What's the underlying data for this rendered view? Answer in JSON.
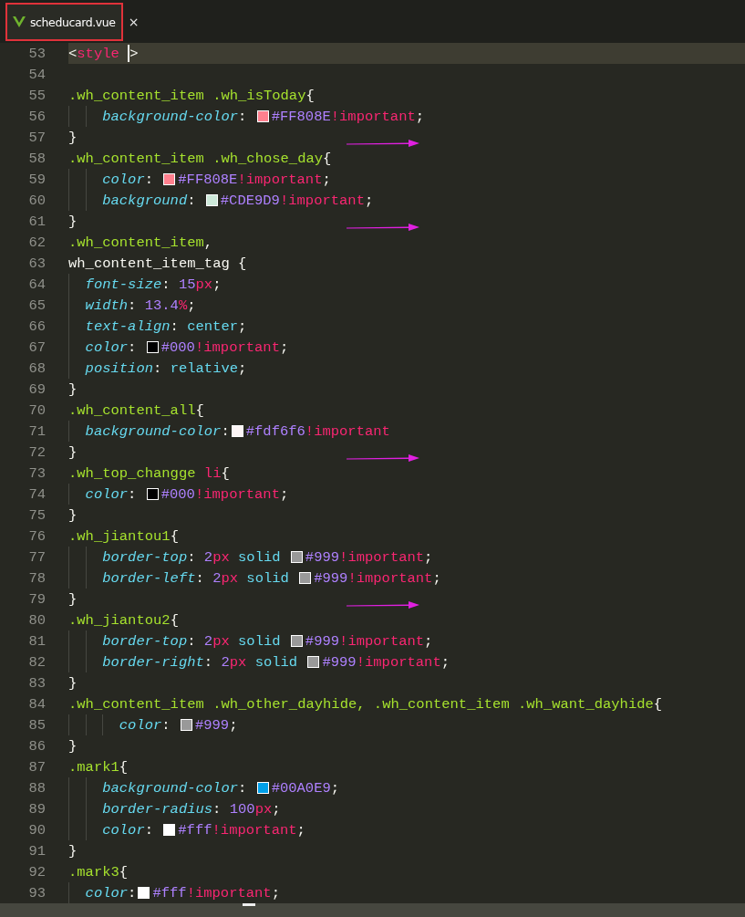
{
  "tab": {
    "title": "scheducard.vue",
    "close": "×",
    "highlighted": true
  },
  "lines": [
    {
      "number": "53",
      "kind": "top",
      "current": true,
      "arrow": false,
      "tokens": [
        {
          "kind": "punct",
          "text": "<"
        },
        {
          "kind": "tag",
          "text": "style"
        },
        {
          "kind": "cursor"
        },
        {
          "kind": "punct",
          "text": ">"
        }
      ]
    },
    {
      "number": "54",
      "kind": "top",
      "current": false,
      "arrow": false
    },
    {
      "number": "55",
      "kind": "top",
      "current": false,
      "arrow": false,
      "tokens": [
        {
          "kind": "sel",
          "text": ".wh_content_item .wh_isToday"
        },
        {
          "kind": "punct",
          "text": "{"
        }
      ]
    },
    {
      "number": "56",
      "kind": "double",
      "current": false,
      "arrow": false,
      "tokens": [
        {
          "kind": "prop",
          "text": "background-color"
        },
        {
          "kind": "punct",
          "text": ": "
        },
        {
          "kind": "swatch",
          "color": "#ff808e"
        },
        {
          "kind": "num",
          "text": "#FF808E"
        },
        {
          "kind": "kw",
          "text": "!important"
        },
        {
          "kind": "punct",
          "text": ";"
        }
      ]
    },
    {
      "number": "57",
      "kind": "top",
      "current": false,
      "arrow": true,
      "tokens": [
        {
          "kind": "punct",
          "text": "}"
        }
      ]
    },
    {
      "number": "58",
      "kind": "top",
      "current": false,
      "arrow": false,
      "tokens": [
        {
          "kind": "sel",
          "text": ".wh_content_item .wh_chose_day"
        },
        {
          "kind": "punct",
          "text": "{"
        }
      ]
    },
    {
      "number": "59",
      "kind": "double",
      "current": false,
      "arrow": false,
      "tokens": [
        {
          "kind": "prop",
          "text": "color"
        },
        {
          "kind": "punct",
          "text": ": "
        },
        {
          "kind": "swatch",
          "color": "#ff808e"
        },
        {
          "kind": "num",
          "text": "#FF808E"
        },
        {
          "kind": "kw",
          "text": "!important"
        },
        {
          "kind": "punct",
          "text": ";"
        }
      ]
    },
    {
      "number": "60",
      "kind": "double",
      "current": false,
      "arrow": false,
      "tokens": [
        {
          "kind": "prop",
          "text": "background"
        },
        {
          "kind": "punct",
          "text": ": "
        },
        {
          "kind": "swatch",
          "color": "#cde9d9"
        },
        {
          "kind": "num",
          "text": "#CDE9D9"
        },
        {
          "kind": "kw",
          "text": "!important"
        },
        {
          "kind": "punct",
          "text": ";"
        }
      ]
    },
    {
      "number": "61",
      "kind": "top",
      "current": false,
      "arrow": true,
      "tokens": [
        {
          "kind": "punct",
          "text": "}"
        }
      ]
    },
    {
      "number": "62",
      "kind": "top",
      "current": false,
      "arrow": false,
      "tokens": [
        {
          "kind": "sel",
          "text": ".wh_content_item"
        },
        {
          "kind": "punct",
          "text": ","
        }
      ]
    },
    {
      "number": "63",
      "kind": "top",
      "current": false,
      "arrow": false,
      "tokens": [
        {
          "kind": "punct",
          "text": "wh_content_item_tag {"
        }
      ]
    },
    {
      "number": "64",
      "kind": "single",
      "current": false,
      "arrow": false,
      "tokens": [
        {
          "kind": "prop",
          "text": "font-size"
        },
        {
          "kind": "punct",
          "text": ": "
        },
        {
          "kind": "num",
          "text": "15"
        },
        {
          "kind": "kw",
          "text": "px"
        },
        {
          "kind": "punct",
          "text": ";"
        }
      ]
    },
    {
      "number": "65",
      "kind": "single",
      "current": false,
      "arrow": false,
      "tokens": [
        {
          "kind": "prop",
          "text": "width"
        },
        {
          "kind": "punct",
          "text": ": "
        },
        {
          "kind": "num",
          "text": "13.4"
        },
        {
          "kind": "kw",
          "text": "%"
        },
        {
          "kind": "punct",
          "text": ";"
        }
      ]
    },
    {
      "number": "66",
      "kind": "single",
      "current": false,
      "arrow": false,
      "tokens": [
        {
          "kind": "prop",
          "text": "text-align"
        },
        {
          "kind": "punct",
          "text": ": "
        },
        {
          "kind": "val",
          "text": "center"
        },
        {
          "kind": "punct",
          "text": ";"
        }
      ]
    },
    {
      "number": "67",
      "kind": "single",
      "current": false,
      "arrow": false,
      "tokens": [
        {
          "kind": "prop",
          "text": "color"
        },
        {
          "kind": "punct",
          "text": ": "
        },
        {
          "kind": "swatch",
          "color": "#000000"
        },
        {
          "kind": "num",
          "text": "#000"
        },
        {
          "kind": "kw",
          "text": "!important"
        },
        {
          "kind": "punct",
          "text": ";"
        }
      ]
    },
    {
      "number": "68",
      "kind": "single",
      "current": false,
      "arrow": false,
      "tokens": [
        {
          "kind": "prop",
          "text": "position"
        },
        {
          "kind": "punct",
          "text": ": "
        },
        {
          "kind": "val",
          "text": "relative"
        },
        {
          "kind": "punct",
          "text": ";"
        }
      ]
    },
    {
      "number": "69",
      "kind": "top",
      "current": false,
      "arrow": false,
      "tokens": [
        {
          "kind": "punct",
          "text": "}"
        }
      ]
    },
    {
      "number": "70",
      "kind": "top",
      "current": false,
      "arrow": false,
      "tokens": [
        {
          "kind": "sel",
          "text": ".wh_content_all"
        },
        {
          "kind": "punct",
          "text": "{"
        }
      ]
    },
    {
      "number": "71",
      "kind": "single",
      "current": false,
      "arrow": false,
      "tokens": [
        {
          "kind": "prop",
          "text": "background-color"
        },
        {
          "kind": "punct",
          "text": ":"
        },
        {
          "kind": "swatch",
          "color": "#fdf6f6"
        },
        {
          "kind": "num",
          "text": "#fdf6f6"
        },
        {
          "kind": "kw",
          "text": "!important"
        }
      ]
    },
    {
      "number": "72",
      "kind": "top",
      "current": false,
      "arrow": true,
      "tokens": [
        {
          "kind": "punct",
          "text": "}"
        }
      ]
    },
    {
      "number": "73",
      "kind": "top",
      "current": false,
      "arrow": false,
      "tokens": [
        {
          "kind": "sel",
          "text": ".wh_top_changge "
        },
        {
          "kind": "kw",
          "text": "li"
        },
        {
          "kind": "punct",
          "text": "{"
        }
      ]
    },
    {
      "number": "74",
      "kind": "single",
      "current": false,
      "arrow": false,
      "tokens": [
        {
          "kind": "prop",
          "text": "color"
        },
        {
          "kind": "punct",
          "text": ": "
        },
        {
          "kind": "swatch",
          "color": "#000000"
        },
        {
          "kind": "num",
          "text": "#000"
        },
        {
          "kind": "kw",
          "text": "!important"
        },
        {
          "kind": "punct",
          "text": ";"
        }
      ]
    },
    {
      "number": "75",
      "kind": "top",
      "current": false,
      "arrow": false,
      "tokens": [
        {
          "kind": "punct",
          "text": "}"
        }
      ]
    },
    {
      "number": "76",
      "kind": "top",
      "current": false,
      "arrow": false,
      "tokens": [
        {
          "kind": "sel",
          "text": ".wh_jiantou1"
        },
        {
          "kind": "punct",
          "text": "{"
        }
      ]
    },
    {
      "number": "77",
      "kind": "double",
      "current": false,
      "arrow": false,
      "tokens": [
        {
          "kind": "prop",
          "text": "border-top"
        },
        {
          "kind": "punct",
          "text": ": "
        },
        {
          "kind": "num",
          "text": "2"
        },
        {
          "kind": "kw",
          "text": "px"
        },
        {
          "kind": "val",
          "text": " solid "
        },
        {
          "kind": "swatch",
          "color": "#999999"
        },
        {
          "kind": "num",
          "text": "#999"
        },
        {
          "kind": "kw",
          "text": "!important"
        },
        {
          "kind": "punct",
          "text": ";"
        }
      ]
    },
    {
      "number": "78",
      "kind": "double",
      "current": false,
      "arrow": false,
      "tokens": [
        {
          "kind": "prop",
          "text": "border-left"
        },
        {
          "kind": "punct",
          "text": ": "
        },
        {
          "kind": "num",
          "text": "2"
        },
        {
          "kind": "kw",
          "text": "px"
        },
        {
          "kind": "val",
          "text": " solid "
        },
        {
          "kind": "swatch",
          "color": "#999999"
        },
        {
          "kind": "num",
          "text": "#999"
        },
        {
          "kind": "kw",
          "text": "!important"
        },
        {
          "kind": "punct",
          "text": ";"
        }
      ]
    },
    {
      "number": "79",
      "kind": "top",
      "current": false,
      "arrow": true,
      "tokens": [
        {
          "kind": "punct",
          "text": "}"
        }
      ]
    },
    {
      "number": "80",
      "kind": "top",
      "current": false,
      "arrow": false,
      "tokens": [
        {
          "kind": "sel",
          "text": ".wh_jiantou2"
        },
        {
          "kind": "punct",
          "text": "{"
        }
      ]
    },
    {
      "number": "81",
      "kind": "double",
      "current": false,
      "arrow": false,
      "tokens": [
        {
          "kind": "prop",
          "text": "border-top"
        },
        {
          "kind": "punct",
          "text": ": "
        },
        {
          "kind": "num",
          "text": "2"
        },
        {
          "kind": "kw",
          "text": "px"
        },
        {
          "kind": "val",
          "text": " solid "
        },
        {
          "kind": "swatch",
          "color": "#999999"
        },
        {
          "kind": "num",
          "text": "#999"
        },
        {
          "kind": "kw",
          "text": "!important"
        },
        {
          "kind": "punct",
          "text": ";"
        }
      ]
    },
    {
      "number": "82",
      "kind": "double",
      "current": false,
      "arrow": false,
      "tokens": [
        {
          "kind": "prop",
          "text": "border-right"
        },
        {
          "kind": "punct",
          "text": ": "
        },
        {
          "kind": "num",
          "text": "2"
        },
        {
          "kind": "kw",
          "text": "px"
        },
        {
          "kind": "val",
          "text": " solid "
        },
        {
          "kind": "swatch",
          "color": "#999999"
        },
        {
          "kind": "num",
          "text": "#999"
        },
        {
          "kind": "kw",
          "text": "!important"
        },
        {
          "kind": "punct",
          "text": ";"
        }
      ]
    },
    {
      "number": "83",
      "kind": "top",
      "current": false,
      "arrow": false,
      "tokens": [
        {
          "kind": "punct",
          "text": "}"
        }
      ]
    },
    {
      "number": "84",
      "kind": "top",
      "current": false,
      "arrow": false,
      "tokens": [
        {
          "kind": "sel",
          "text": ".wh_content_item .wh_other_dayhide, .wh_content_item .wh_want_dayhide"
        },
        {
          "kind": "punct",
          "text": "{"
        }
      ]
    },
    {
      "number": "85",
      "kind": "triple",
      "current": false,
      "arrow": false,
      "tokens": [
        {
          "kind": "prop",
          "text": "color"
        },
        {
          "kind": "punct",
          "text": ": "
        },
        {
          "kind": "swatch",
          "color": "#999999"
        },
        {
          "kind": "num",
          "text": "#999"
        },
        {
          "kind": "punct",
          "text": ";"
        }
      ]
    },
    {
      "number": "86",
      "kind": "top",
      "current": false,
      "arrow": false,
      "tokens": [
        {
          "kind": "punct",
          "text": "}"
        }
      ]
    },
    {
      "number": "87",
      "kind": "top",
      "current": false,
      "arrow": false,
      "tokens": [
        {
          "kind": "sel",
          "text": ".mark1"
        },
        {
          "kind": "punct",
          "text": "{"
        }
      ]
    },
    {
      "number": "88",
      "kind": "double",
      "current": false,
      "arrow": false,
      "tokens": [
        {
          "kind": "prop",
          "text": "background-color"
        },
        {
          "kind": "punct",
          "text": ": "
        },
        {
          "kind": "swatch",
          "color": "#00a0e9"
        },
        {
          "kind": "num",
          "text": "#00A0E9"
        },
        {
          "kind": "punct",
          "text": ";"
        }
      ]
    },
    {
      "number": "89",
      "kind": "double",
      "current": false,
      "arrow": false,
      "tokens": [
        {
          "kind": "prop",
          "text": "border-radius"
        },
        {
          "kind": "punct",
          "text": ": "
        },
        {
          "kind": "num",
          "text": "100"
        },
        {
          "kind": "kw",
          "text": "px"
        },
        {
          "kind": "punct",
          "text": ";"
        }
      ]
    },
    {
      "number": "90",
      "kind": "double",
      "current": false,
      "arrow": false,
      "tokens": [
        {
          "kind": "prop",
          "text": "color"
        },
        {
          "kind": "punct",
          "text": ": "
        },
        {
          "kind": "swatch",
          "color": "#ffffff"
        },
        {
          "kind": "num",
          "text": "#fff"
        },
        {
          "kind": "kw",
          "text": "!important"
        },
        {
          "kind": "punct",
          "text": ";"
        }
      ]
    },
    {
      "number": "91",
      "kind": "top",
      "current": false,
      "arrow": false,
      "tokens": [
        {
          "kind": "punct",
          "text": "}"
        }
      ]
    },
    {
      "number": "92",
      "kind": "top",
      "current": false,
      "arrow": false,
      "tokens": [
        {
          "kind": "sel",
          "text": ".mark3"
        },
        {
          "kind": "punct",
          "text": "{"
        }
      ]
    },
    {
      "number": "93",
      "kind": "single",
      "current": false,
      "arrow": false,
      "tokens": [
        {
          "kind": "prop",
          "text": "color"
        },
        {
          "kind": "punct",
          "text": ":"
        },
        {
          "kind": "swatch",
          "color": "#ffffff"
        },
        {
          "kind": "num",
          "text": "#fff"
        },
        {
          "kind": "kw",
          "text": "!important"
        },
        {
          "kind": "punct",
          "text": ";"
        }
      ]
    }
  ]
}
